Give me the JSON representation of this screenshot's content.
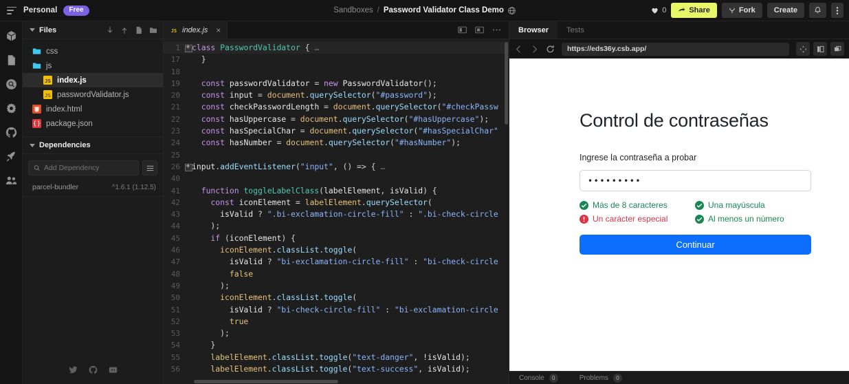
{
  "topbar": {
    "workspace": "Personal",
    "plan_badge": "Free",
    "breadcrumb_root": "Sandboxes",
    "breadcrumb_sep": "/",
    "breadcrumb_current": "Password Validator Class Demo",
    "likes_count": "0",
    "share_label": "Share",
    "fork_label": "Fork",
    "create_label": "Create"
  },
  "rail": {
    "items": [
      {
        "icon": "cube-icon"
      },
      {
        "icon": "file-icon"
      },
      {
        "icon": "search-icon"
      },
      {
        "icon": "gear-icon"
      },
      {
        "icon": "github-icon"
      },
      {
        "icon": "rocket-icon"
      },
      {
        "icon": "people-icon"
      }
    ]
  },
  "sidebar": {
    "files_title": "Files",
    "tree": [
      {
        "name": "css",
        "type": "folder",
        "indent": false,
        "active": false
      },
      {
        "name": "js",
        "type": "folder",
        "indent": false,
        "active": false
      },
      {
        "name": "index.js",
        "type": "js",
        "indent": true,
        "active": true
      },
      {
        "name": "passwordValidator.js",
        "type": "js",
        "indent": true,
        "active": false
      },
      {
        "name": "index.html",
        "type": "html",
        "indent": false,
        "active": false
      },
      {
        "name": "package.json",
        "type": "json",
        "indent": false,
        "active": false
      }
    ],
    "dependencies_title": "Dependencies",
    "add_dependency_placeholder": "Add Dependency",
    "dependencies": [
      {
        "name": "parcel-bundler",
        "version": "^1.6.1 (1.12.5)"
      }
    ],
    "footer_icons": [
      "twitter-icon",
      "github-icon",
      "discord-icon"
    ]
  },
  "editor": {
    "tab_label": "index.js",
    "tab_close": "×",
    "lines": [
      {
        "no": "1",
        "fold": true,
        "hl": true,
        "tokens": [
          {
            "t": "class ",
            "c": "kw"
          },
          {
            "t": "PasswordValidator ",
            "c": "cls"
          },
          {
            "t": "{",
            "c": "punc"
          },
          {
            "t": " …",
            "c": "dots"
          }
        ]
      },
      {
        "no": "17",
        "fold": false,
        "hl": false,
        "tokens": [
          {
            "t": "  }",
            "c": "punc"
          }
        ]
      },
      {
        "no": "18",
        "fold": false,
        "hl": false,
        "tokens": []
      },
      {
        "no": "19",
        "fold": false,
        "hl": false,
        "tokens": [
          {
            "t": "  const ",
            "c": "kw"
          },
          {
            "t": "passwordValidator ",
            "c": "var"
          },
          {
            "t": "= ",
            "c": "punc"
          },
          {
            "t": "new ",
            "c": "kw"
          },
          {
            "t": "PasswordValidator",
            "c": "var"
          },
          {
            "t": "();",
            "c": "punc"
          }
        ]
      },
      {
        "no": "20",
        "fold": false,
        "hl": false,
        "tokens": [
          {
            "t": "  const ",
            "c": "kw"
          },
          {
            "t": "input ",
            "c": "var"
          },
          {
            "t": "= ",
            "c": "punc"
          },
          {
            "t": "document",
            "c": "obj"
          },
          {
            "t": ".",
            "c": "punc"
          },
          {
            "t": "querySelector",
            "c": "prop"
          },
          {
            "t": "(",
            "c": "punc"
          },
          {
            "t": "\"#password\"",
            "c": "str2"
          },
          {
            "t": ");",
            "c": "punc"
          }
        ]
      },
      {
        "no": "21",
        "fold": false,
        "hl": false,
        "tokens": [
          {
            "t": "  const ",
            "c": "kw"
          },
          {
            "t": "checkPasswordLength ",
            "c": "var"
          },
          {
            "t": "= ",
            "c": "punc"
          },
          {
            "t": "document",
            "c": "obj"
          },
          {
            "t": ".",
            "c": "punc"
          },
          {
            "t": "querySelector",
            "c": "prop"
          },
          {
            "t": "(",
            "c": "punc"
          },
          {
            "t": "\"#checkPassw",
            "c": "str2"
          }
        ]
      },
      {
        "no": "22",
        "fold": false,
        "hl": false,
        "tokens": [
          {
            "t": "  const ",
            "c": "kw"
          },
          {
            "t": "hasUppercase ",
            "c": "var"
          },
          {
            "t": "= ",
            "c": "punc"
          },
          {
            "t": "document",
            "c": "obj"
          },
          {
            "t": ".",
            "c": "punc"
          },
          {
            "t": "querySelector",
            "c": "prop"
          },
          {
            "t": "(",
            "c": "punc"
          },
          {
            "t": "\"#hasUppercase\"",
            "c": "str2"
          },
          {
            "t": ");",
            "c": "punc"
          }
        ]
      },
      {
        "no": "23",
        "fold": false,
        "hl": false,
        "tokens": [
          {
            "t": "  const ",
            "c": "kw"
          },
          {
            "t": "hasSpecialChar ",
            "c": "var"
          },
          {
            "t": "= ",
            "c": "punc"
          },
          {
            "t": "document",
            "c": "obj"
          },
          {
            "t": ".",
            "c": "punc"
          },
          {
            "t": "querySelector",
            "c": "prop"
          },
          {
            "t": "(",
            "c": "punc"
          },
          {
            "t": "\"#hasSpecialChar\"",
            "c": "str2"
          }
        ]
      },
      {
        "no": "24",
        "fold": false,
        "hl": false,
        "tokens": [
          {
            "t": "  const ",
            "c": "kw"
          },
          {
            "t": "hasNumber ",
            "c": "var"
          },
          {
            "t": "= ",
            "c": "punc"
          },
          {
            "t": "document",
            "c": "obj"
          },
          {
            "t": ".",
            "c": "punc"
          },
          {
            "t": "querySelector",
            "c": "prop"
          },
          {
            "t": "(",
            "c": "punc"
          },
          {
            "t": "\"#hasNumber\"",
            "c": "str2"
          },
          {
            "t": ");",
            "c": "punc"
          }
        ]
      },
      {
        "no": "25",
        "fold": false,
        "hl": false,
        "tokens": []
      },
      {
        "no": "26",
        "fold": true,
        "hl": false,
        "tokens": [
          {
            "t": "input",
            "c": "var"
          },
          {
            "t": ".",
            "c": "punc"
          },
          {
            "t": "addEventListener",
            "c": "prop"
          },
          {
            "t": "(",
            "c": "punc"
          },
          {
            "t": "\"input\"",
            "c": "str2"
          },
          {
            "t": ", () => {",
            "c": "punc"
          },
          {
            "t": " …",
            "c": "dots"
          }
        ]
      },
      {
        "no": "40",
        "fold": false,
        "hl": false,
        "tokens": []
      },
      {
        "no": "41",
        "fold": false,
        "hl": false,
        "tokens": [
          {
            "t": "  function ",
            "c": "kw"
          },
          {
            "t": "toggleLabelClass",
            "c": "cls"
          },
          {
            "t": "(",
            "c": "punc"
          },
          {
            "t": "labelElement",
            "c": "var"
          },
          {
            "t": ", ",
            "c": "punc"
          },
          {
            "t": "isValid",
            "c": "var"
          },
          {
            "t": ") {",
            "c": "punc"
          }
        ]
      },
      {
        "no": "42",
        "fold": false,
        "hl": false,
        "tokens": [
          {
            "t": "    const ",
            "c": "kw"
          },
          {
            "t": "iconElement ",
            "c": "var"
          },
          {
            "t": "= ",
            "c": "punc"
          },
          {
            "t": "labelElement",
            "c": "obj"
          },
          {
            "t": ".",
            "c": "punc"
          },
          {
            "t": "querySelector",
            "c": "prop"
          },
          {
            "t": "(",
            "c": "punc"
          }
        ]
      },
      {
        "no": "43",
        "fold": false,
        "hl": false,
        "tokens": [
          {
            "t": "      isValid ",
            "c": "var"
          },
          {
            "t": "? ",
            "c": "punc"
          },
          {
            "t": "\".bi-exclamation-circle-fill\"",
            "c": "str2"
          },
          {
            "t": " : ",
            "c": "punc"
          },
          {
            "t": "\".bi-check-circle",
            "c": "str2"
          }
        ]
      },
      {
        "no": "44",
        "fold": false,
        "hl": false,
        "tokens": [
          {
            "t": "    );",
            "c": "punc"
          }
        ]
      },
      {
        "no": "45",
        "fold": false,
        "hl": false,
        "tokens": [
          {
            "t": "    if ",
            "c": "kw"
          },
          {
            "t": "(",
            "c": "punc"
          },
          {
            "t": "iconElement",
            "c": "var"
          },
          {
            "t": ") {",
            "c": "punc"
          }
        ]
      },
      {
        "no": "46",
        "fold": false,
        "hl": false,
        "tokens": [
          {
            "t": "      iconElement",
            "c": "obj"
          },
          {
            "t": ".",
            "c": "punc"
          },
          {
            "t": "classList",
            "c": "prop"
          },
          {
            "t": ".",
            "c": "punc"
          },
          {
            "t": "toggle",
            "c": "prop"
          },
          {
            "t": "(",
            "c": "punc"
          }
        ]
      },
      {
        "no": "47",
        "fold": false,
        "hl": false,
        "tokens": [
          {
            "t": "        isValid ",
            "c": "var"
          },
          {
            "t": "? ",
            "c": "punc"
          },
          {
            "t": "\"bi-exclamation-circle-fill\"",
            "c": "str2"
          },
          {
            "t": " : ",
            "c": "punc"
          },
          {
            "t": "\"bi-check-circle",
            "c": "str2"
          }
        ]
      },
      {
        "no": "48",
        "fold": false,
        "hl": false,
        "tokens": [
          {
            "t": "        false",
            "c": "obj"
          }
        ]
      },
      {
        "no": "49",
        "fold": false,
        "hl": false,
        "tokens": [
          {
            "t": "      );",
            "c": "punc"
          }
        ]
      },
      {
        "no": "50",
        "fold": false,
        "hl": false,
        "tokens": [
          {
            "t": "      iconElement",
            "c": "obj"
          },
          {
            "t": ".",
            "c": "punc"
          },
          {
            "t": "classList",
            "c": "prop"
          },
          {
            "t": ".",
            "c": "punc"
          },
          {
            "t": "toggle",
            "c": "prop"
          },
          {
            "t": "(",
            "c": "punc"
          }
        ]
      },
      {
        "no": "51",
        "fold": false,
        "hl": false,
        "tokens": [
          {
            "t": "        isValid ",
            "c": "var"
          },
          {
            "t": "? ",
            "c": "punc"
          },
          {
            "t": "\"bi-check-circle-fill\"",
            "c": "str2"
          },
          {
            "t": " : ",
            "c": "punc"
          },
          {
            "t": "\"bi-exclamation-circle",
            "c": "str2"
          }
        ]
      },
      {
        "no": "52",
        "fold": false,
        "hl": false,
        "tokens": [
          {
            "t": "        true",
            "c": "obj"
          }
        ]
      },
      {
        "no": "53",
        "fold": false,
        "hl": false,
        "tokens": [
          {
            "t": "      );",
            "c": "punc"
          }
        ]
      },
      {
        "no": "54",
        "fold": false,
        "hl": false,
        "tokens": [
          {
            "t": "    }",
            "c": "punc"
          }
        ]
      },
      {
        "no": "55",
        "fold": false,
        "hl": false,
        "tokens": [
          {
            "t": "    labelElement",
            "c": "obj"
          },
          {
            "t": ".",
            "c": "punc"
          },
          {
            "t": "classList",
            "c": "prop"
          },
          {
            "t": ".",
            "c": "punc"
          },
          {
            "t": "toggle",
            "c": "prop"
          },
          {
            "t": "(",
            "c": "punc"
          },
          {
            "t": "\"text-danger\"",
            "c": "str2"
          },
          {
            "t": ", ",
            "c": "punc"
          },
          {
            "t": "!isValid",
            "c": "var"
          },
          {
            "t": ");",
            "c": "punc"
          }
        ]
      },
      {
        "no": "56",
        "fold": false,
        "hl": false,
        "tokens": [
          {
            "t": "    labelElement",
            "c": "obj"
          },
          {
            "t": ".",
            "c": "punc"
          },
          {
            "t": "classList",
            "c": "prop"
          },
          {
            "t": ".",
            "c": "punc"
          },
          {
            "t": "toggle",
            "c": "prop"
          },
          {
            "t": "(",
            "c": "punc"
          },
          {
            "t": "\"text-success\"",
            "c": "str2"
          },
          {
            "t": ", ",
            "c": "punc"
          },
          {
            "t": "isValid",
            "c": "var"
          },
          {
            "t": ");",
            "c": "punc"
          }
        ]
      }
    ]
  },
  "preview": {
    "tabs": [
      {
        "label": "Browser",
        "active": true
      },
      {
        "label": "Tests",
        "active": false
      }
    ],
    "url": "https://eds36y.csb.app/",
    "page": {
      "heading": "Control de contraseñas",
      "field_label": "Ingrese la contraseña a probar",
      "password_value": "•••••••••",
      "checks": [
        {
          "label": "Más de 8 caracteres",
          "state": "ok"
        },
        {
          "label": "Una mayúscula",
          "state": "ok"
        },
        {
          "label": "Un carácter especial",
          "state": "bad"
        },
        {
          "label": "Al menos un número",
          "state": "ok"
        }
      ],
      "submit_label": "Continuar",
      "accent_color": "#0d6efd",
      "ok_color": "#198754",
      "bad_color": "#dc3545"
    }
  },
  "statusbar": {
    "console_label": "Console",
    "console_count": "0",
    "problems_label": "Problems",
    "problems_count": "0"
  }
}
